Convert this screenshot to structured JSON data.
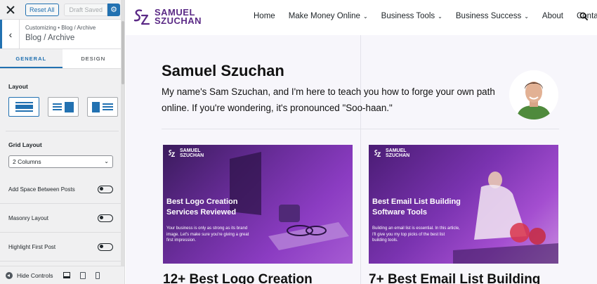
{
  "customizer": {
    "reset_label": "Reset All",
    "draft_label": "Draft Saved",
    "breadcrumb": "Customizing • Blog / Archive",
    "panel_title": "Blog / Archive",
    "tabs": [
      {
        "label": "GENERAL",
        "active": true
      },
      {
        "label": "DESIGN",
        "active": false
      }
    ],
    "layout_label": "Layout",
    "layout_options": [
      "full-width",
      "sidebar-right",
      "sidebar-left"
    ],
    "layout_selected": "full-width",
    "grid_label": "Grid Layout",
    "grid_value": "2 Columns",
    "toggles": [
      {
        "label": "Add Space Between Posts",
        "on": false
      },
      {
        "label": "Masonry Layout",
        "on": false
      },
      {
        "label": "Highlight First Post",
        "on": false
      }
    ],
    "hide_controls_label": "Hide Controls",
    "accent_color": "#2271b1"
  },
  "site": {
    "logo_line1": "SAMUEL",
    "logo_line2": "SZUCHAN",
    "brand_color": "#5b2a86",
    "nav": [
      {
        "label": "Home",
        "dropdown": false
      },
      {
        "label": "Make Money Online",
        "dropdown": true
      },
      {
        "label": "Business Tools",
        "dropdown": true
      },
      {
        "label": "Business Success",
        "dropdown": true
      },
      {
        "label": "About",
        "dropdown": false
      },
      {
        "label": "Contact",
        "dropdown": false
      }
    ],
    "hero_title": "Samuel Szuchan",
    "hero_text": "My name's Sam Szuchan, and I'm here to teach you how to forge your own path online. If you're wondering, it's pronounced \"Soo-haan.\"",
    "posts": [
      {
        "image_title": "Best Logo Creation Services Reviewed",
        "image_desc": "Your business is only as strong as its brand image. Let's make sure you're giving a great first impression.",
        "title": "12+ Best Logo Creation"
      },
      {
        "image_title": "Best Email List Building Software Tools",
        "image_desc": "Building an email list is essential. In this article, I'll give you my top picks of the best list building tools.",
        "title": "7+ Best Email List Building"
      }
    ]
  }
}
